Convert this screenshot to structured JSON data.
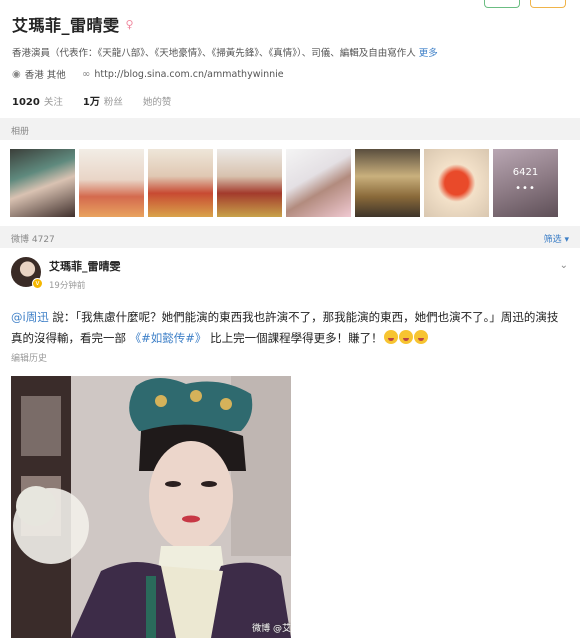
{
  "profile": {
    "name": "艾瑪菲_雷晴雯",
    "bio": "香港演員（代表作：《天龍八部》、《天地豪情》、《掃黃先鋒》、《真情》）、司儀、編輯及自由寫作人",
    "bio_more": "更多",
    "location": "香港 其他",
    "blog_url": "http://blog.sina.com.cn/ammathywinnie",
    "following_count": "1020",
    "following_label": "关注",
    "followers_count": "1万",
    "followers_label": "粉丝",
    "likes_label": "她的赞"
  },
  "album": {
    "section_label": "相册",
    "photo_count": "6421",
    "more_dots": "•••"
  },
  "feed": {
    "count_label": "微博 4727",
    "filter_label": "筛选"
  },
  "post": {
    "author": "艾瑪菲_雷晴雯",
    "time": "19分钟前",
    "mention": "@i周迅",
    "text_1": " 說：「我焦慮什麼呢？她們能演的東西我也許演不了，那我能演的東西，她們也演不了。」周迅的演技真的沒得輸，看完一部 ",
    "topic": "《#如懿传#》",
    "text_2": " 比上完一個課程學得更多！賺了！",
    "edit_history": "编辑历史",
    "watermark": "微博 @艾"
  },
  "colors": {
    "link_blue": "#3d7fc7",
    "bar_grey": "#f2f2f2",
    "verified_yellow": "#f5b700"
  }
}
